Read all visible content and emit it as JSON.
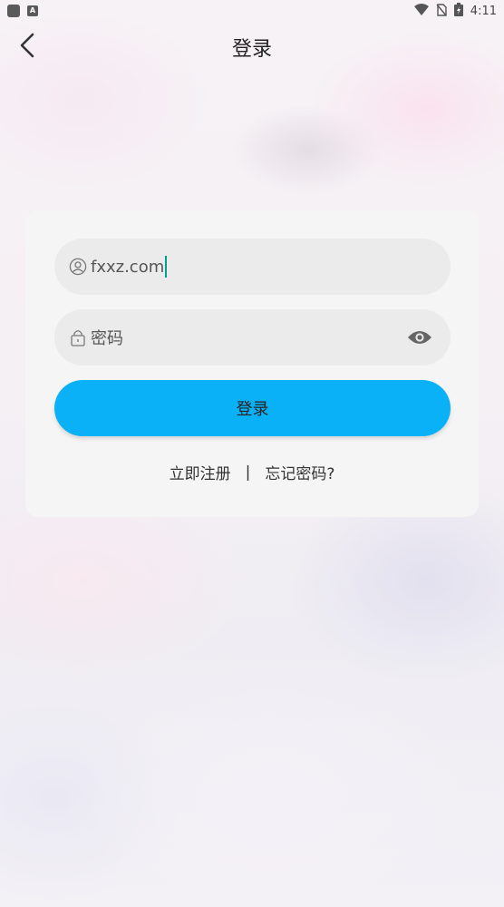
{
  "status_bar": {
    "time": "4:11",
    "icons": [
      "app-icon",
      "a-icon",
      "wifi-icon",
      "no-sim-icon",
      "battery-icon"
    ]
  },
  "header": {
    "title": "登录",
    "back_icon": "chevron-left-icon"
  },
  "form": {
    "username": {
      "value": "fxxz.com",
      "icon": "user-icon"
    },
    "password": {
      "placeholder": "密码",
      "icon": "lock-icon",
      "toggle_icon": "eye-icon"
    },
    "login_label": "登录",
    "accent_color": "#0bb1f7"
  },
  "links": {
    "register": "立即注册",
    "separator": "|",
    "forgot": "忘记密码?"
  }
}
